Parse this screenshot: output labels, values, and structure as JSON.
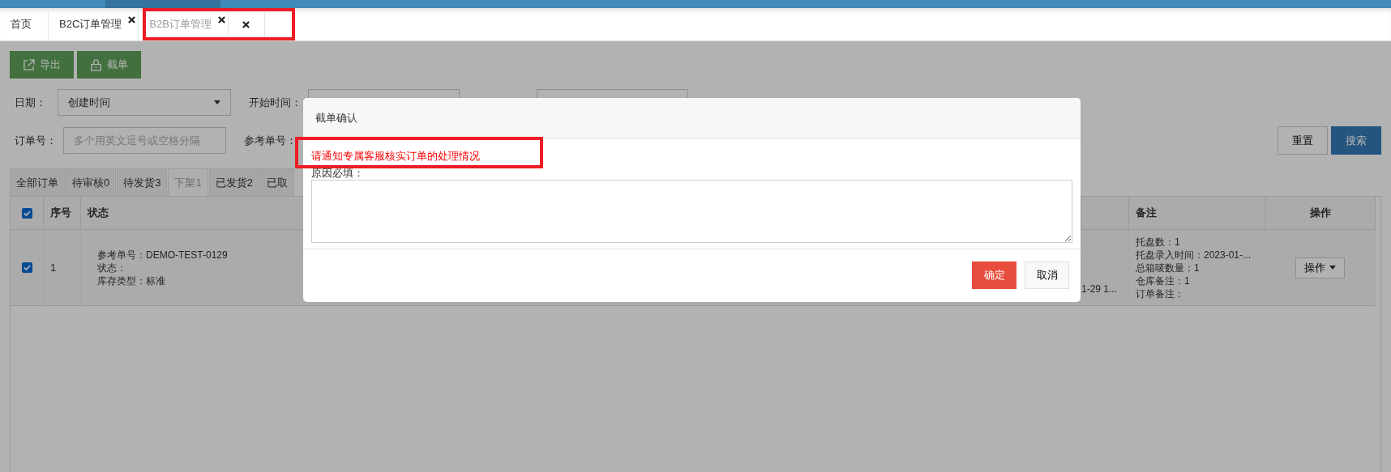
{
  "tab_bar": {
    "tabs": [
      {
        "label": "首页",
        "selected": false,
        "closable": false
      },
      {
        "label": "B2C订单管理",
        "selected": false,
        "closable": true
      },
      {
        "label": "B2B订单管理",
        "selected": true,
        "closable": true
      }
    ]
  },
  "toolbar": {
    "buttons": [
      {
        "kind": "export",
        "label": "导出"
      },
      {
        "kind": "lock",
        "label": "截单"
      }
    ]
  },
  "filters": {
    "date_label": "日期：",
    "date_select": "创建时间",
    "start_label": "开始时间：",
    "order_label": "订单号：",
    "order_placeholder": "多个用英文逗号或空格分隔",
    "ref_label": "参考单号：",
    "reset": "重置",
    "search": "搜索"
  },
  "status_tabs": [
    {
      "label": "全部订单",
      "selected": false
    },
    {
      "label": "待审核0",
      "selected": false
    },
    {
      "label": "待发货3",
      "selected": false
    },
    {
      "label": "下架1",
      "selected": true
    },
    {
      "label": "已发货2",
      "selected": false
    },
    {
      "label": "已取",
      "selected": false
    }
  ],
  "table": {
    "header_checked": true,
    "columns": {
      "seq": "序号",
      "status": "状态",
      "remarks": "备注",
      "actions": "操作"
    },
    "rows": [
      {
        "checked": true,
        "index": "1",
        "status_lines": [
          "参考单号：DEMO-TEST-0129",
          "状态：",
          "库存类型：标准"
        ],
        "column_4_lines": [
          "1-29 1..."
        ],
        "remarks_lines": [
          "托盘数：1",
          "托盘录入时间：2023-01-...",
          "总箱唛数量：1",
          "仓库备注：1",
          "订单备注："
        ],
        "action": "操作"
      }
    ]
  },
  "modal": {
    "title": "截单确认",
    "warning": "请通知专属客服核实订单的处理情况",
    "reason_label": "原因必填：",
    "confirm": "确定",
    "cancel": "取消"
  }
}
